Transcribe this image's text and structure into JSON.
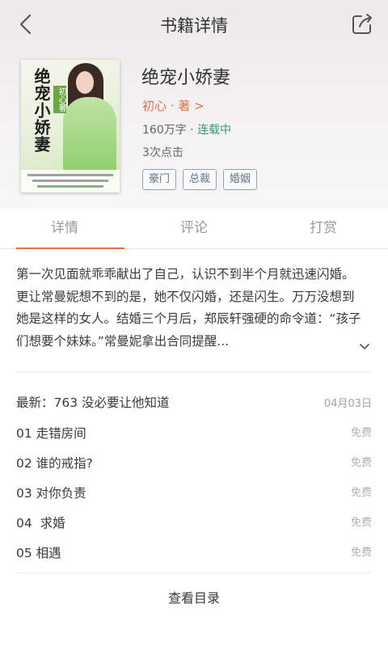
{
  "header": {
    "title": "书籍详情",
    "back_icon": "chevron-left-icon",
    "share_icon": "share-icon"
  },
  "book": {
    "cover_title": "绝宠小娇妻",
    "cover_author": "初心著",
    "name": "绝宠小娇妻",
    "author_label": "初心 · 著 >",
    "words": "160万字 · ",
    "status": "连载中",
    "clicks": "3次点击",
    "tags": [
      "豪门",
      "总裁",
      "婚姻"
    ]
  },
  "tabs": [
    "详情",
    "评论",
    "打赏"
  ],
  "synopsis": "第一次见面就乖乖献出了自己，认识不到半个月就迅速闪婚。更让常曼妮想不到的是，她不仅闪婚，还是闪生。万万没想到她是这样的女人。结婚三个月后，郑辰轩强硬的命令道：“孩子们想要个妹妹。”常曼妮拿出合同提醒...",
  "latest": {
    "text": "最新：763 没必要让他知道",
    "date": "04月03日"
  },
  "chapters": [
    {
      "title": "01 走错房间",
      "price": "免费"
    },
    {
      "title": "02 谁的戒指?",
      "price": "免费"
    },
    {
      "title": "03 对你负责",
      "price": "免费"
    },
    {
      "title": "04  求婚",
      "price": "免费"
    },
    {
      "title": "05 相遇",
      "price": "免费"
    }
  ],
  "catalog_label": "查看目录",
  "colors": {
    "accent": "#e86f4a",
    "status_green": "#3d9a6c",
    "tag_border": "#8ea3b0"
  }
}
